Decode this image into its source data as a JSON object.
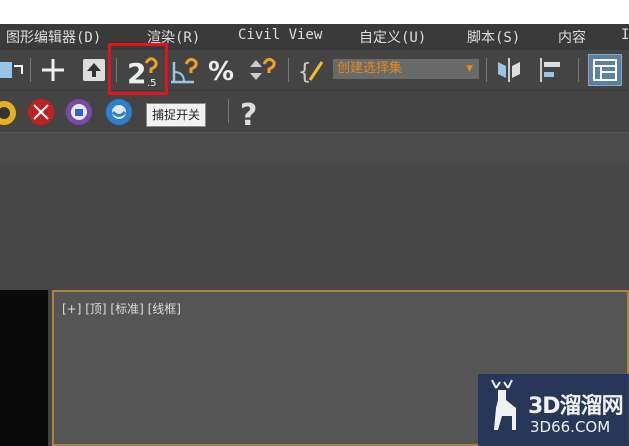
{
  "menu": {
    "items": [
      "图形编辑器(D)",
      "渲染(R)",
      "Civil View",
      "自定义(U)",
      "脚本(S)",
      "内容",
      "I"
    ]
  },
  "toolbar": {
    "selection_set_placeholder": "创建选择集",
    "snap_value": "2",
    "snap_sub": ".5",
    "tooltip": "捕捉开关",
    "help_glyph": "?"
  },
  "viewport": {
    "label": "[+] [顶] [标准] [线框]"
  },
  "watermark": {
    "title": "3D溜溜网",
    "url": "3D66.COM"
  },
  "colors": {
    "accent_orange": "#e68a1c",
    "highlight_red": "#e0141b",
    "viewport_border": "#a6863a"
  }
}
